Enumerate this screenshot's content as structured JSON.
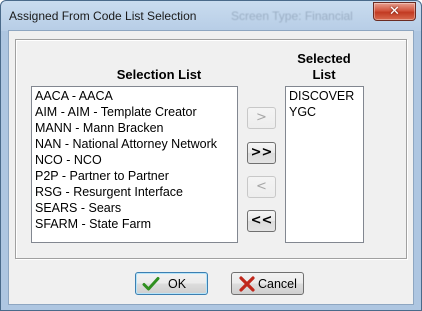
{
  "window": {
    "title": "Assigned From Code List Selection",
    "background_title": "Screen Type: Financial",
    "close_glyph": "✕"
  },
  "selection_list": {
    "heading": "Selection List",
    "items": [
      "AACA - AACA",
      "AIM - AIM - Template Creator",
      "MANN - Mann Bracken",
      "NAN - National Attorney Network",
      "NCO - NCO",
      "P2P - Partner to Partner",
      "RSG - Resurgent Interface",
      "SEARS - Sears",
      "SFARM - State Farm"
    ]
  },
  "selected_list": {
    "heading_line1": "Selected",
    "heading_line2": "List",
    "items": [
      "DISCOVER",
      "YGC"
    ]
  },
  "transfer_buttons": {
    "add": {
      "label": ">",
      "enabled": false
    },
    "add_all": {
      "label": ">>",
      "enabled": true
    },
    "remove": {
      "label": "<",
      "enabled": false
    },
    "remove_all": {
      "label": "<<",
      "enabled": true
    }
  },
  "dialog_buttons": {
    "ok_label": "OK",
    "cancel_label": "Cancel"
  },
  "icons": {
    "ok": "checkmark-icon",
    "cancel": "cancel-x-icon"
  },
  "colors": {
    "ok_check": "#2f8f1f",
    "cancel_x": "#c0281c",
    "title_bar": "#b9cfe7"
  }
}
